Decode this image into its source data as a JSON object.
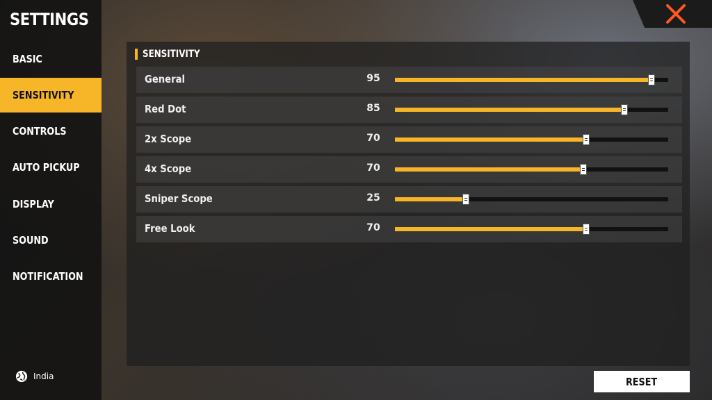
{
  "sidebar": {
    "title": "SETTINGS",
    "items": [
      {
        "label": "BASIC",
        "active": false
      },
      {
        "label": "SENSITIVITY",
        "active": true
      },
      {
        "label": "CONTROLS",
        "active": false
      },
      {
        "label": "AUTO PICKUP",
        "active": false
      },
      {
        "label": "DISPLAY",
        "active": false
      },
      {
        "label": "SOUND",
        "active": false
      },
      {
        "label": "NOTIFICATION",
        "active": false
      }
    ],
    "region": {
      "icon": "globe-icon",
      "label": "India"
    }
  },
  "header": {
    "close_icon": "close-icon"
  },
  "main": {
    "section_title": "SENSITIVITY",
    "sliders": [
      {
        "label": "General",
        "value": "95",
        "fraction": 0.94
      },
      {
        "label": "Red Dot",
        "value": "85",
        "fraction": 0.84
      },
      {
        "label": "2x Scope",
        "value": "70",
        "fraction": 0.7
      },
      {
        "label": "4x Scope",
        "value": "70",
        "fraction": 0.69
      },
      {
        "label": "Sniper Scope",
        "value": "25",
        "fraction": 0.26
      },
      {
        "label": "Free Look",
        "value": "70",
        "fraction": 0.7
      }
    ],
    "reset_label": "RESET"
  },
  "colors": {
    "accent": "#f6b628",
    "close": "#ff5a1f",
    "track": "#111111"
  }
}
